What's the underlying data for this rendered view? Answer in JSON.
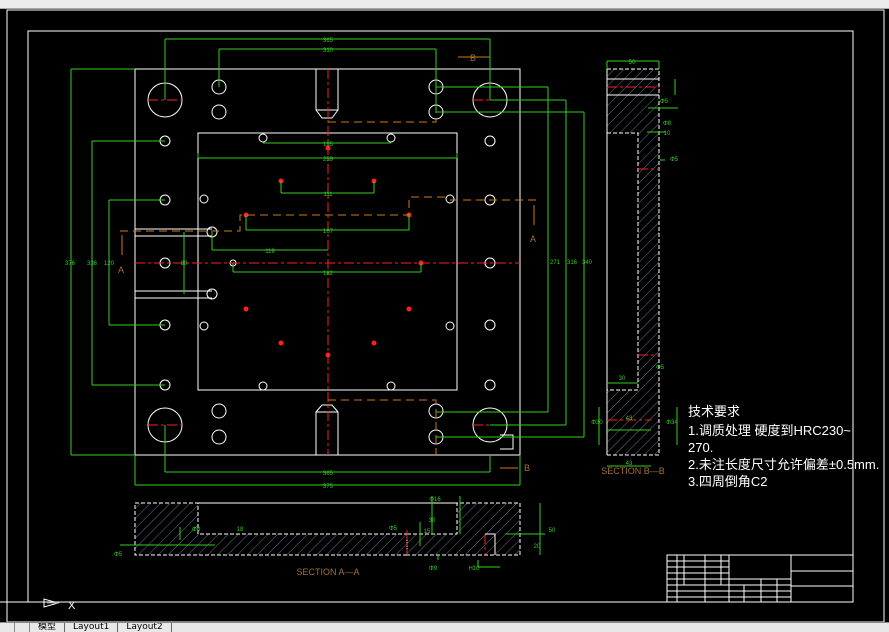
{
  "app": {
    "toolbar": "cad-toolbar"
  },
  "tabs": [
    {
      "label": "模型"
    },
    {
      "label": "Layout1"
    },
    {
      "label": "Layout2"
    }
  ],
  "colors": {
    "background": "#000000",
    "outline": "#ffffff",
    "dimension": "#33cc22",
    "centerline": "#ff2020",
    "section_line": "#d07a10",
    "hatch": "#7a90b0"
  },
  "drawing": {
    "plan_dims": {
      "top_outer": "365",
      "top_inner": "310",
      "pocket_holes": "195",
      "pocket_width": "259",
      "pins_top": "111",
      "pins_mid": "167",
      "offset": "119",
      "pins_bottom": "182",
      "bottom_inner": "365",
      "bottom_outer": "375",
      "left_outer": "376",
      "left_mid": "336",
      "left_inner": "120",
      "left_small": "80",
      "right_1": "271",
      "right_2": "316",
      "right_3": "340"
    },
    "section_marks": {
      "a": "A",
      "b": "B"
    },
    "section_aa": {
      "title": "SECTION A—A",
      "dims": [
        "Φ5",
        "Φ8",
        "18",
        "Φ5",
        "15",
        "Φ16",
        "30",
        "Φ9",
        "H10",
        "50",
        "20"
      ]
    },
    "section_bb": {
      "title": "SECTION B—B",
      "dims": [
        "50",
        "Φ5",
        "Φ8",
        "10",
        "Φ5",
        "Φ5",
        "30",
        "43",
        "Φ30",
        "Φ34",
        "43"
      ]
    },
    "notes": {
      "title": "技术要求",
      "lines": [
        "1.调质处理 硬度到HRC230~",
        "270.",
        "2.未注长度尺寸允许偏差±0.5mm.",
        "3.四周倒角C2"
      ]
    },
    "ucs": {
      "x_label": "X"
    }
  }
}
